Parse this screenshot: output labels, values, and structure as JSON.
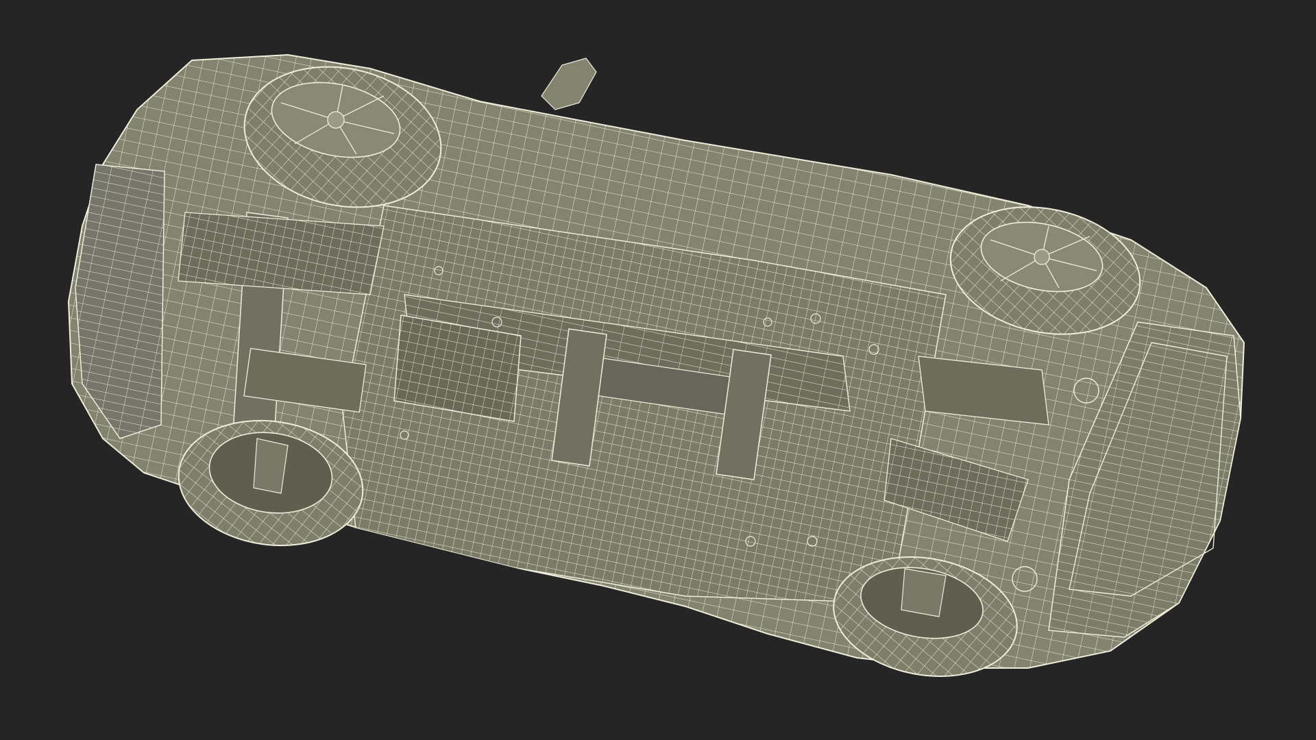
{
  "scene": {
    "background_color": "#252525",
    "surface_color": "#84836f",
    "surface_shadow_color": "#5f5e4f",
    "wire_color": "#efeedd",
    "subject": "car-underside-wireframe"
  }
}
